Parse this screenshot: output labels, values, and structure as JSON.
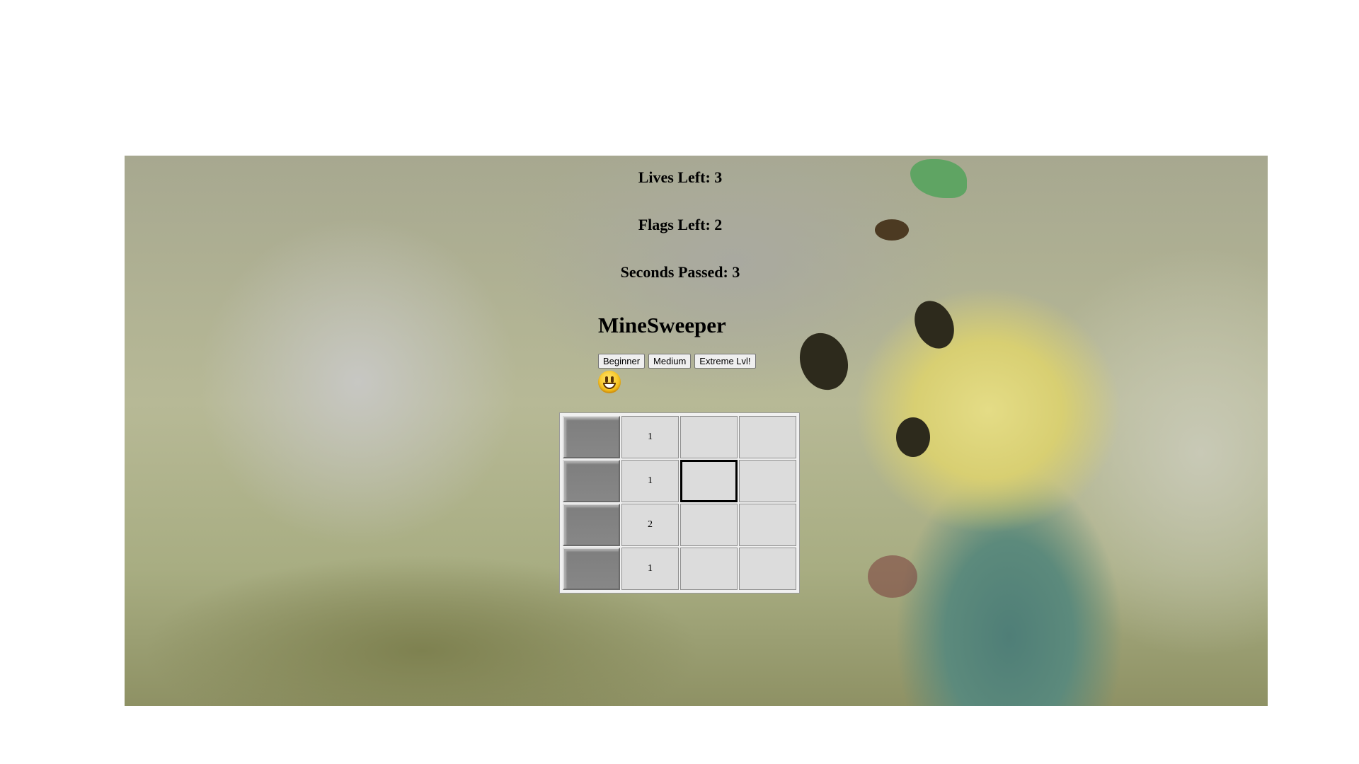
{
  "stats": {
    "lives": "Lives Left: 3",
    "flags": "Flags Left: 2",
    "seconds": "Seconds Passed: 3"
  },
  "title": "MineSweeper",
  "levels": [
    "Beginner",
    "Medium",
    "Extreme Lvl!"
  ],
  "smiley_icon": "smiley-face-icon",
  "board": {
    "rows": [
      [
        {
          "state": "hidden",
          "text": ""
        },
        {
          "state": "revealed",
          "text": "1"
        },
        {
          "state": "revealed",
          "text": ""
        },
        {
          "state": "revealed",
          "text": ""
        }
      ],
      [
        {
          "state": "hidden",
          "text": ""
        },
        {
          "state": "revealed",
          "text": "1"
        },
        {
          "state": "selected",
          "text": ""
        },
        {
          "state": "revealed",
          "text": ""
        }
      ],
      [
        {
          "state": "hidden",
          "text": ""
        },
        {
          "state": "revealed",
          "text": "2"
        },
        {
          "state": "revealed",
          "text": ""
        },
        {
          "state": "revealed",
          "text": ""
        }
      ],
      [
        {
          "state": "hidden",
          "text": ""
        },
        {
          "state": "revealed",
          "text": "1"
        },
        {
          "state": "revealed",
          "text": ""
        },
        {
          "state": "revealed",
          "text": ""
        }
      ]
    ]
  }
}
